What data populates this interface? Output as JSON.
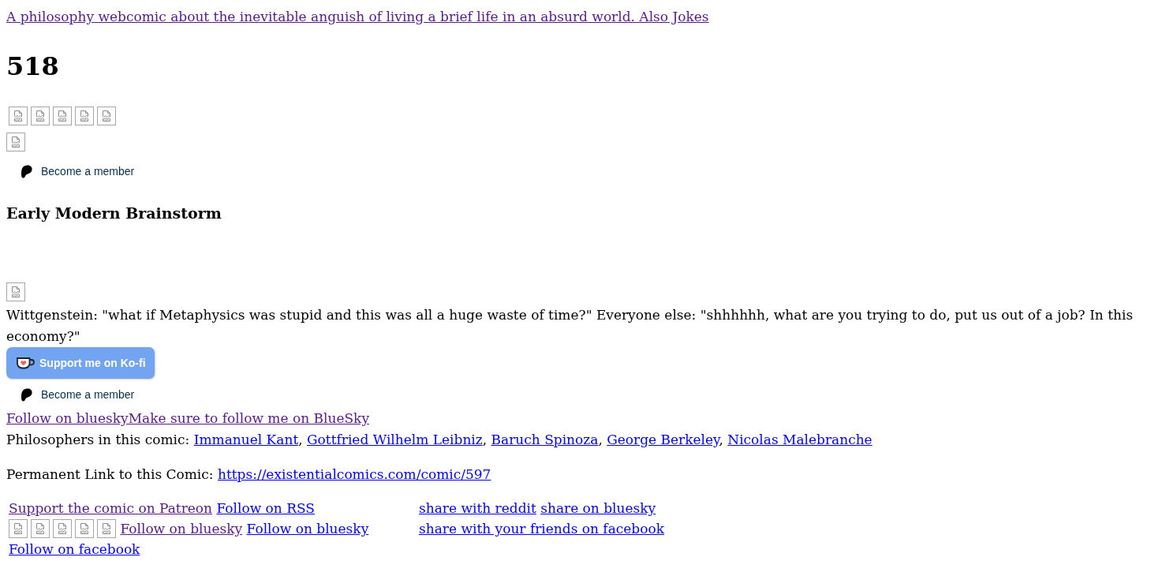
{
  "tagline": {
    "text": "A philosophy webcomic about the inevitable anguish of living a brief life in an absurd world. Also Jokes",
    "visited": true
  },
  "comic_number": "518",
  "top_buttons": [
    {
      "kind": "member",
      "label": "Become a member"
    }
  ],
  "comic": {
    "title": "Early Modern Brainstorm",
    "caption": "Wittgenstein: \"what if Metaphysics was stupid and this was all a huge waste of time?\" Everyone else: \"shhhhhh, what are you trying to do, put us out of a job? In this economy?\""
  },
  "support_buttons": [
    {
      "kind": "kofi",
      "label": "Support me on Ko-fi"
    },
    {
      "kind": "member",
      "label": "Become a member"
    }
  ],
  "bluesky_link": {
    "text": "Follow on blueskyMake sure to follow me on BlueSky",
    "visited": true
  },
  "philosophers": {
    "label": "Philosophers in this comic:",
    "separator": ",",
    "links": [
      {
        "text": "Immanuel Kant",
        "visited": false
      },
      {
        "text": "Gottfried Wilhelm Leibniz",
        "visited": false
      },
      {
        "text": "Baruch Spinoza",
        "visited": false
      },
      {
        "text": "George Berkeley",
        "visited": false
      },
      {
        "text": "Nicolas Malebranche",
        "visited": false
      }
    ]
  },
  "permalink": {
    "label": "Permanent Link to this Comic:",
    "link": {
      "text": "https://existentialcomics.com/comic/597",
      "visited": false
    }
  },
  "footer": {
    "follow_links": [
      {
        "text": "Support the comic on Patreon",
        "visited": true
      },
      {
        "text": "Follow on RSS",
        "visited": false
      },
      {
        "text": "Follow on bluesky",
        "visited": true
      },
      {
        "text": "Follow on bluesky",
        "visited": false
      },
      {
        "text": "Follow on facebook",
        "visited": false
      }
    ],
    "share_links": [
      {
        "text": "share with reddit",
        "visited": false
      },
      {
        "text": "share on bluesky",
        "visited": false
      },
      {
        "text": "share with your friends on facebook",
        "visited": false
      }
    ]
  }
}
